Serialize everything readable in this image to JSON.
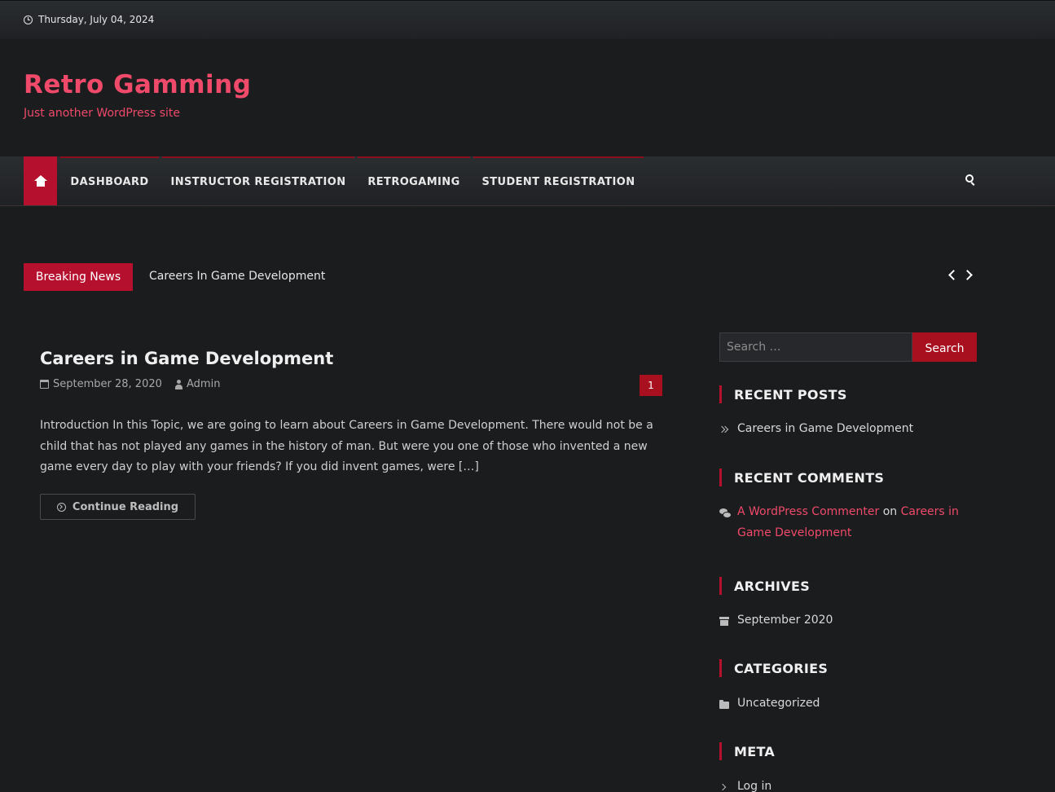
{
  "topbar": {
    "date": "Thursday, July 04, 2024"
  },
  "site": {
    "title": "Retro Gamming",
    "tagline": "Just another WordPress site"
  },
  "nav": {
    "items": [
      {
        "label": "DASHBOARD"
      },
      {
        "label": "INSTRUCTOR REGISTRATION"
      },
      {
        "label": "RETROGAMING"
      },
      {
        "label": "STUDENT REGISTRATION"
      }
    ]
  },
  "ticker": {
    "badge": "Breaking News",
    "headline": "Careers In Game Development"
  },
  "post": {
    "title": "Careers in Game Development",
    "date": "September 28, 2020",
    "author": "Admin",
    "comment_count": "1",
    "excerpt": "Introduction In this Topic, we are going to learn about Careers in Game Development. There would not be a child that has not played any games in the history of man. But were you one of those who invented a new game every day to play with your friends? If you did invent games, were […]",
    "continue_label": "Continue Reading"
  },
  "sidebar": {
    "search": {
      "placeholder": "Search …",
      "button": "Search"
    },
    "recent_posts": {
      "title": "RECENT POSTS",
      "items": [
        "Careers in Game Development"
      ]
    },
    "recent_comments": {
      "title": "RECENT COMMENTS",
      "author": "A WordPress Commenter",
      "on": "on",
      "post": "Careers in Game Development"
    },
    "archives": {
      "title": "ARCHIVES",
      "items": [
        "September 2020"
      ]
    },
    "categories": {
      "title": "CATEGORIES",
      "items": [
        "Uncategorized"
      ]
    },
    "meta": {
      "title": "META",
      "items": [
        "Log in"
      ]
    }
  },
  "colors": {
    "accent": "#b5102d",
    "link": "#ef4a6a",
    "background": "#1b1c1e"
  }
}
